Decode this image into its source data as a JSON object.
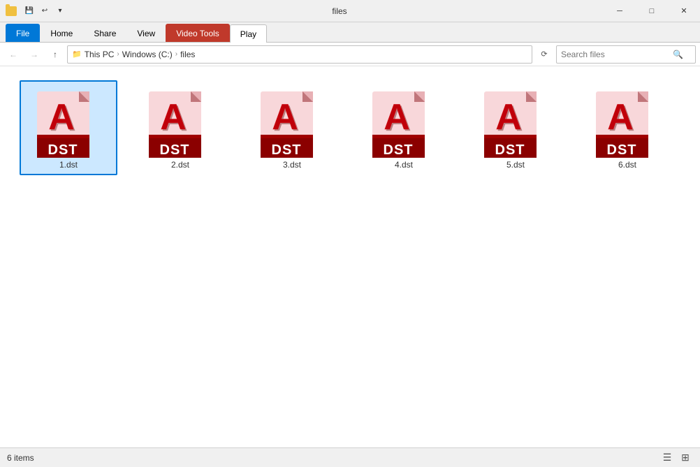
{
  "titleBar": {
    "title": "files",
    "controls": {
      "minimize": "─",
      "maximize": "□",
      "close": "✕"
    }
  },
  "ribbon": {
    "tabs": [
      {
        "id": "file",
        "label": "File",
        "class": "file"
      },
      {
        "id": "home",
        "label": "Home",
        "class": ""
      },
      {
        "id": "share",
        "label": "Share",
        "class": ""
      },
      {
        "id": "view",
        "label": "View",
        "class": ""
      },
      {
        "id": "video-tools",
        "label": "Video Tools",
        "class": "video-tools"
      },
      {
        "id": "play",
        "label": "Play",
        "class": "active"
      }
    ]
  },
  "navBar": {
    "breadcrumb": [
      "This PC",
      "Windows (C:)",
      "files"
    ],
    "searchPlaceholder": "Search files"
  },
  "files": [
    {
      "id": "1",
      "name": "1.dst",
      "selected": true
    },
    {
      "id": "2",
      "name": "2.dst",
      "selected": false
    },
    {
      "id": "3",
      "name": "3.dst",
      "selected": false
    },
    {
      "id": "4",
      "name": "4.dst",
      "selected": false
    },
    {
      "id": "5",
      "name": "5.dst",
      "selected": false
    },
    {
      "id": "6",
      "name": "6.dst",
      "selected": false
    }
  ],
  "statusBar": {
    "itemCount": "6 items"
  }
}
